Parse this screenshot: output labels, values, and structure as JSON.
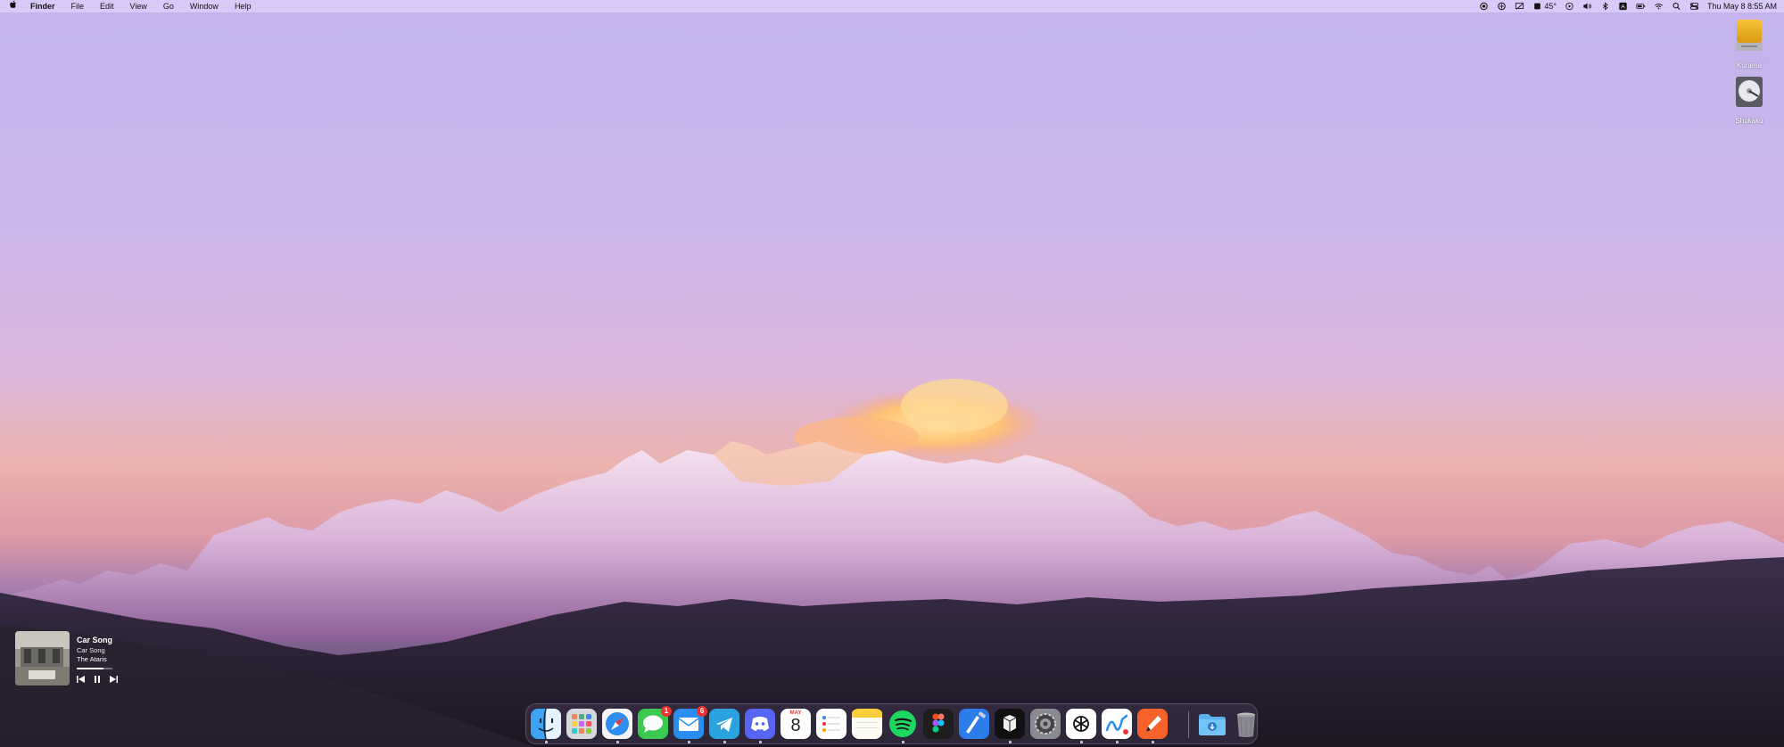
{
  "menubar": {
    "app_name": "Finder",
    "menus": [
      "File",
      "Edit",
      "View",
      "Go",
      "Window",
      "Help"
    ],
    "weather_temp": "45°",
    "datetime": "Thu May 8  8:55 AM",
    "status_icons": [
      "screen-record-icon",
      "activity-icon",
      "display-icon",
      "weather-icon",
      "play-icon",
      "volume-icon",
      "bluetooth-icon",
      "input-source-icon",
      "battery-icon",
      "wifi-icon",
      "spotlight-icon",
      "control-center-icon"
    ]
  },
  "desktop": {
    "drives": [
      {
        "label": "Kurama",
        "icon": "external-drive-icon"
      },
      {
        "label": "Shukaku",
        "icon": "hard-disk-icon"
      }
    ]
  },
  "now_playing": {
    "title": "Car Song",
    "album": "Car Song",
    "artist": "The Ataris",
    "progress": 0.75
  },
  "dock": {
    "apps": [
      {
        "name": "Finder",
        "icon": "finder-icon",
        "running": true
      },
      {
        "name": "Launchpad",
        "icon": "launchpad-icon",
        "running": false
      },
      {
        "name": "Safari",
        "icon": "safari-icon",
        "running": true
      },
      {
        "name": "Messages",
        "icon": "messages-icon",
        "running": false,
        "badge": "1"
      },
      {
        "name": "Mail",
        "icon": "mail-icon",
        "running": true,
        "badge": "6"
      },
      {
        "name": "Telegram",
        "icon": "telegram-icon",
        "running": true
      },
      {
        "name": "Discord",
        "icon": "discord-icon",
        "running": true
      },
      {
        "name": "Calendar",
        "icon": "calendar-icon",
        "running": false,
        "month": "MAY",
        "day": "8"
      },
      {
        "name": "Reminders",
        "icon": "reminders-icon",
        "running": false
      },
      {
        "name": "Notes",
        "icon": "notes-icon",
        "running": false
      },
      {
        "name": "Spotify",
        "icon": "spotify-icon",
        "running": true
      },
      {
        "name": "Figma",
        "icon": "figma-icon",
        "running": false
      },
      {
        "name": "Xcode",
        "icon": "xcode-icon",
        "running": false
      },
      {
        "name": "Parallels",
        "icon": "parallels-icon",
        "running": true
      },
      {
        "name": "System Settings",
        "icon": "settings-icon",
        "running": false
      },
      {
        "name": "ChatGPT",
        "icon": "chatgpt-icon",
        "running": true
      },
      {
        "name": "Freeform",
        "icon": "freeform-icon",
        "running": true
      },
      {
        "name": "Pencil",
        "icon": "pencil-app-icon",
        "running": true
      }
    ],
    "folder": {
      "name": "Downloads",
      "icon": "downloads-folder-icon"
    },
    "trash": {
      "name": "Trash",
      "icon": "trash-icon"
    }
  },
  "colors": {
    "sky_top": "#c4b4ec",
    "sky_horizon": "#e5b3aa",
    "snow": "#f3e1f2",
    "foothills": "#2e2538"
  }
}
